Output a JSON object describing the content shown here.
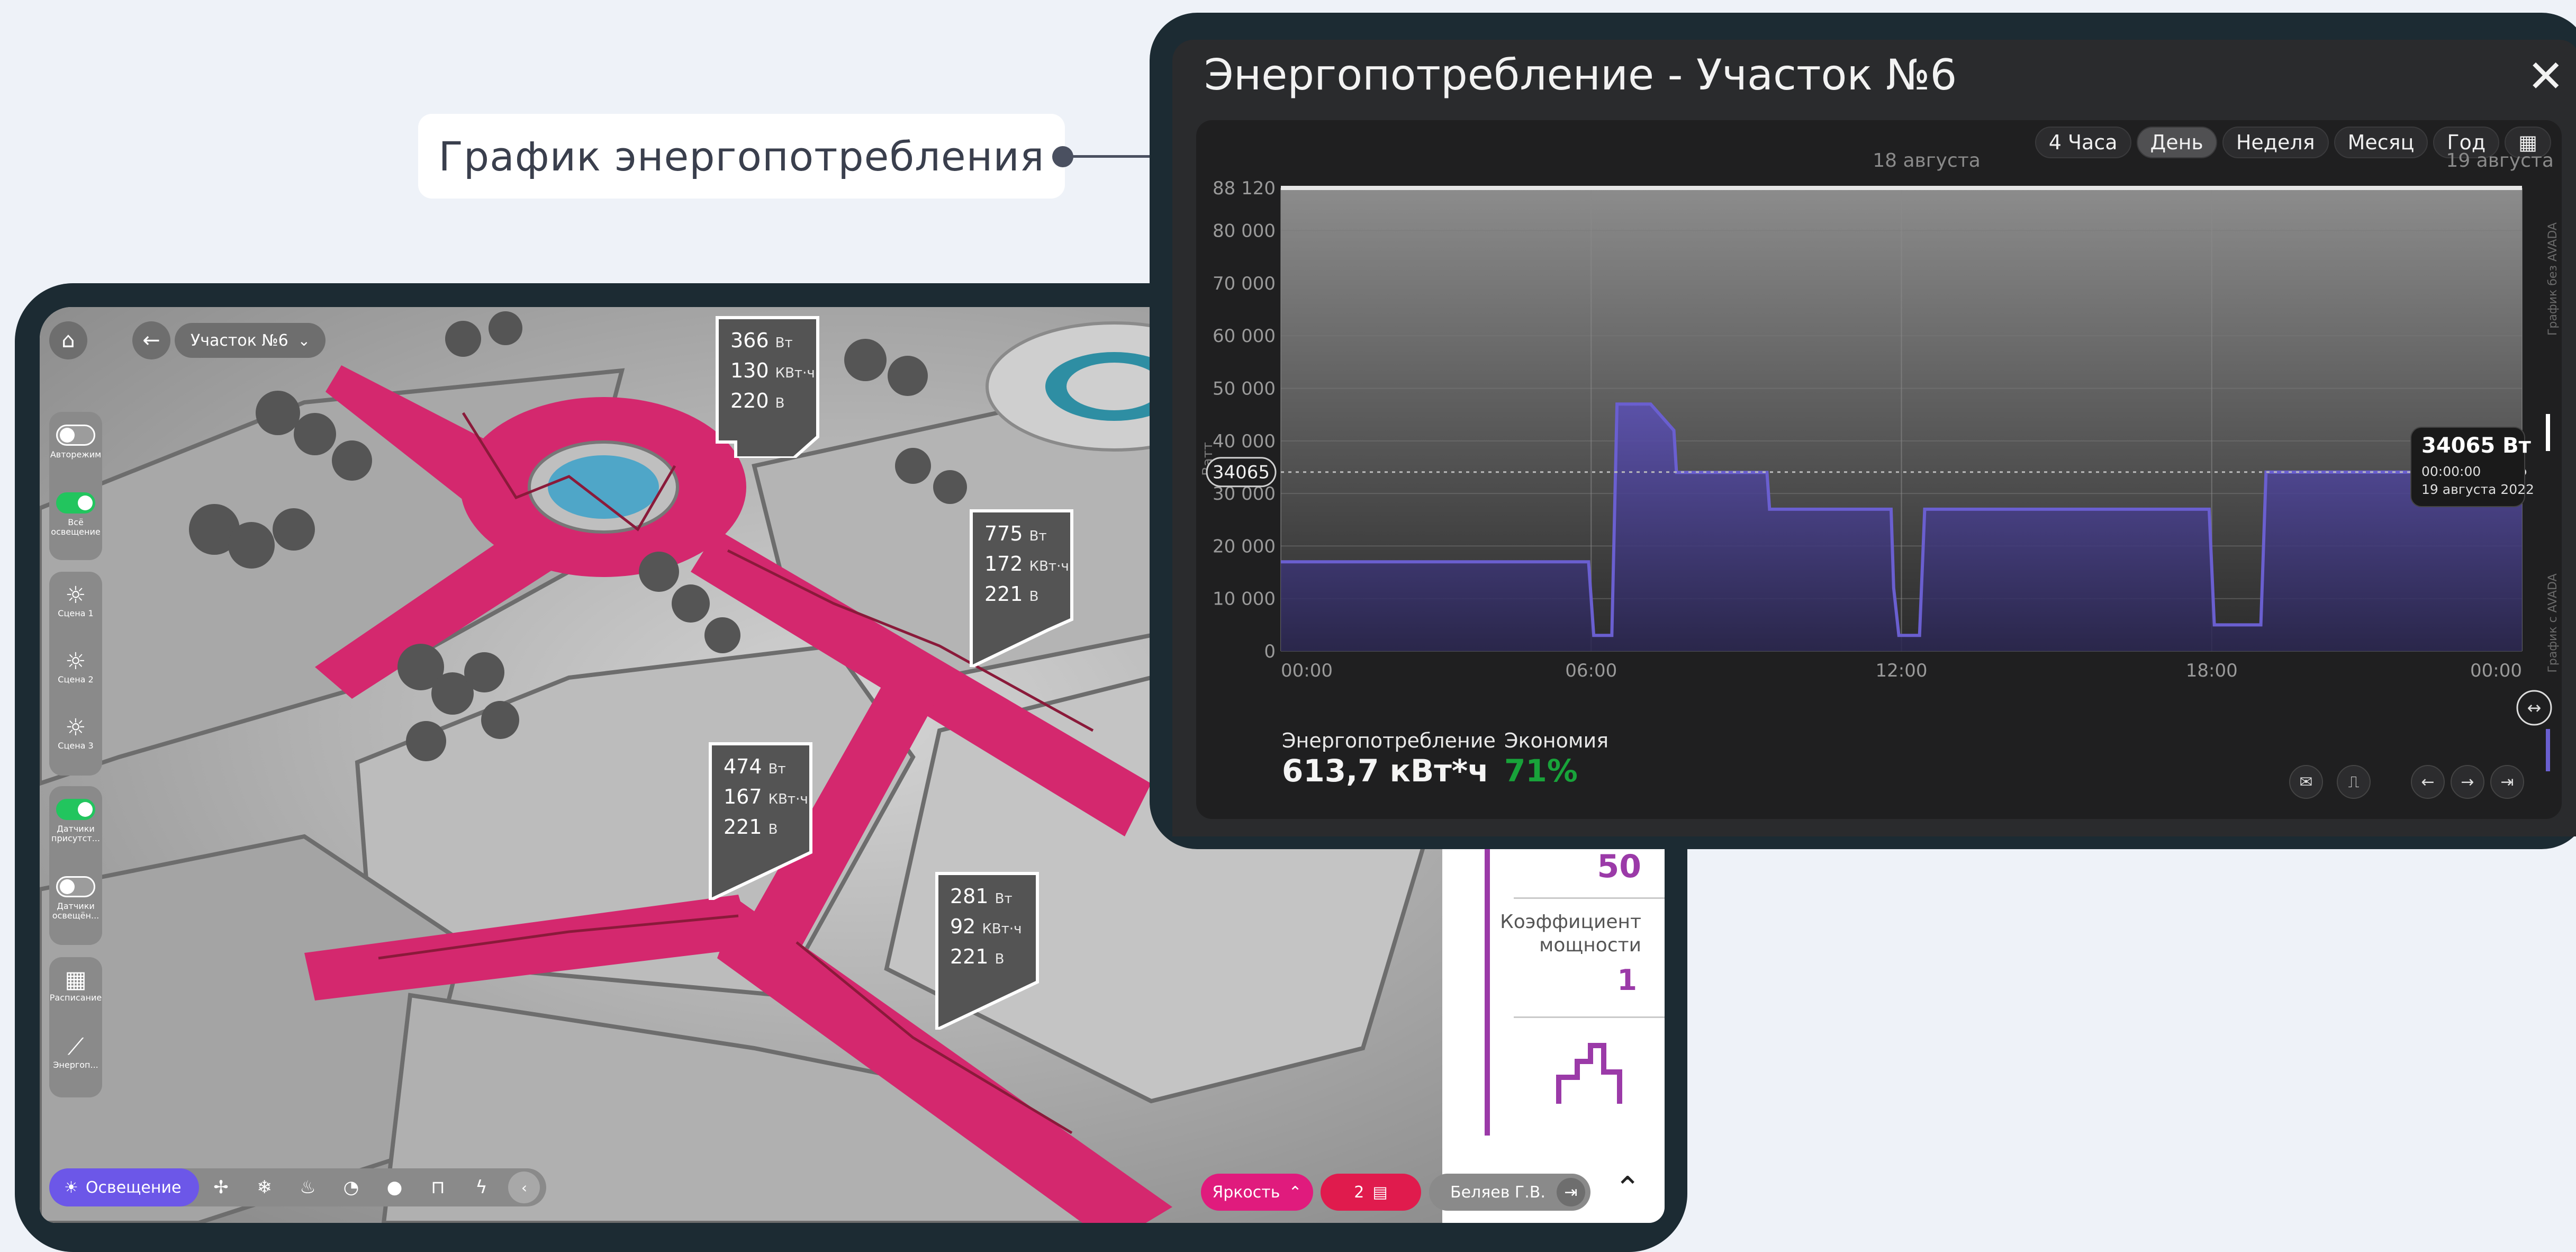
{
  "caption": {
    "text": "График энергопотребления"
  },
  "map_view": {
    "area_selector": "Участок №6",
    "side_panel": {
      "autoregime": "Авторежим",
      "all_lighting": "Всё освещение",
      "scene1": "Сцена 1",
      "scene2": "Сцена 2",
      "scene3": "Сцена 3",
      "presence_sensors": "Датчики присутст...",
      "light_sensors": "Датчики освещён...",
      "schedule": "Расписание",
      "energy": "Энергоп..."
    },
    "callouts": [
      {
        "power": "366",
        "power_unit": "Вт",
        "energy": "130",
        "energy_unit": "КВт·ч",
        "voltage": "220",
        "voltage_unit": "В"
      },
      {
        "power": "775",
        "power_unit": "Вт",
        "energy": "172",
        "energy_unit": "КВт·ч",
        "voltage": "221",
        "voltage_unit": "В"
      },
      {
        "power": "474",
        "power_unit": "Вт",
        "energy": "167",
        "energy_unit": "КВт·ч",
        "voltage": "221",
        "voltage_unit": "В"
      },
      {
        "power": "281",
        "power_unit": "Вт",
        "energy": "92",
        "energy_unit": "КВт·ч",
        "voltage": "221",
        "voltage_unit": "В"
      }
    ],
    "right_panel": {
      "value_top": "50",
      "power_factor_label": "Коэффициент мощности",
      "power_factor_value": "1"
    },
    "bottom_bar": {
      "lighting_label": "Освещение",
      "brightness_label": "Яркость",
      "docs_count": "2",
      "user_name": "Беляев Г.В."
    }
  },
  "chart_window": {
    "title": "Энергопотребление - Участок №6",
    "ranges": [
      "4 Часа",
      "День",
      "Неделя",
      "Месяц",
      "Год"
    ],
    "active_range": "День",
    "date_left": "18 августа",
    "date_right": "19 августа",
    "ylabel": "Ватт",
    "right_label_top": "График без AVADA",
    "right_label_bottom": "График с AVADA",
    "crosshair_label": "34065",
    "tooltip": {
      "value": "34065 Вт",
      "time": "00:00:00",
      "date": "19 августа 2022"
    },
    "stats": {
      "consumption_label": "Энергопотребление",
      "consumption_value": "613,7 кВт*ч",
      "savings_label": "Экономия",
      "savings_value": "71%"
    },
    "colors": {
      "series": "#6a5fd0",
      "savings": "#18a33a",
      "accent": "#e01b7d"
    }
  },
  "chart_data": {
    "type": "area",
    "title": "Энергопотребление - Участок №6",
    "xlabel": "",
    "ylabel": "Ватт",
    "x_ticks": [
      "00:00",
      "06:00",
      "12:00",
      "18:00",
      "00:00"
    ],
    "y_ticks": [
      "0",
      "10 000",
      "20 000",
      "30 000",
      "40 000",
      "50 000",
      "60 000",
      "70 000",
      "80 000",
      "88 120"
    ],
    "xlim_hours": [
      0,
      24
    ],
    "ylim": [
      0,
      88120
    ],
    "series": [
      {
        "name": "График без AVADA",
        "type": "line",
        "x_hours": [
          0,
          24
        ],
        "values": [
          88120,
          88120
        ]
      },
      {
        "name": "График с AVADA",
        "type": "area",
        "x_hours": [
          0,
          5.95,
          6.05,
          6.4,
          6.5,
          7.15,
          7.6,
          7.65,
          9.4,
          9.45,
          11.8,
          11.85,
          11.95,
          12.35,
          12.45,
          17.95,
          18.05,
          18.95,
          19.05,
          24
        ],
        "values": [
          17000,
          17000,
          3000,
          3000,
          47000,
          47000,
          42000,
          34000,
          34000,
          27000,
          27000,
          12000,
          3000,
          3000,
          27000,
          27000,
          5000,
          5000,
          34065,
          34065
        ]
      }
    ],
    "grid": true,
    "legend": "none"
  }
}
